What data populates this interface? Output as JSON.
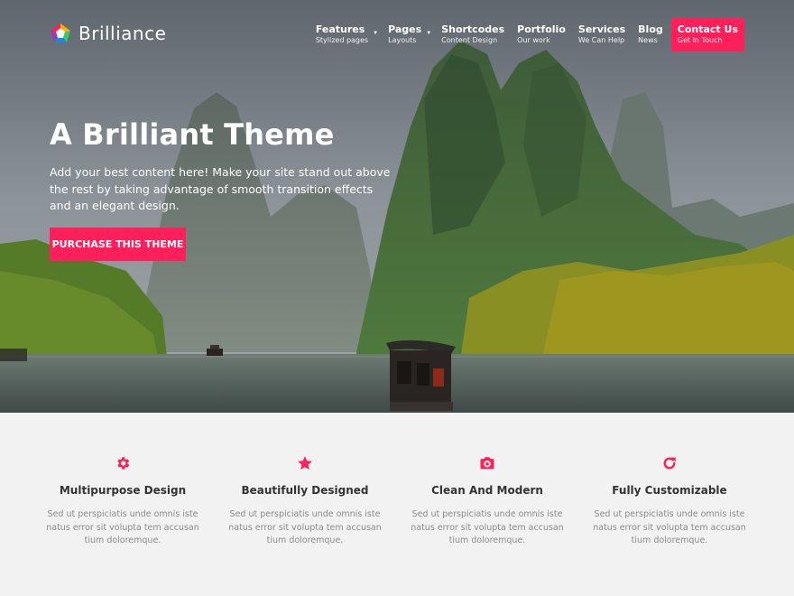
{
  "brand": {
    "name": "Brilliance",
    "accent": "#ff1f5a"
  },
  "nav": {
    "items": [
      {
        "title": "Features",
        "subtitle": "Stylized pages",
        "has_dropdown": true
      },
      {
        "title": "Pages",
        "subtitle": "Layouts",
        "has_dropdown": true
      },
      {
        "title": "Shortcodes",
        "subtitle": "Content Design",
        "has_dropdown": false
      },
      {
        "title": "Portfolio",
        "subtitle": "Our work",
        "has_dropdown": false
      },
      {
        "title": "Services",
        "subtitle": "We Can Help",
        "has_dropdown": false
      },
      {
        "title": "Blog",
        "subtitle": "News",
        "has_dropdown": false
      }
    ],
    "cta": {
      "title": "Contact Us",
      "subtitle": "Get In Touch"
    }
  },
  "hero": {
    "title": "A Brilliant Theme",
    "text": "Add your best content here! Make your site stand out above the rest by taking advantage of smooth transition effects and an elegant design.",
    "button_label": "PURCHASE THIS THEME"
  },
  "features": [
    {
      "icon": "gear-icon",
      "title": "Multipurpose Design",
      "description": "Sed ut perspiciatis unde omnis iste natus error sit volupta tem accusan tium doloremque."
    },
    {
      "icon": "star-icon",
      "title": "Beautifully Designed",
      "description": "Sed ut perspiciatis unde omnis iste natus error sit volupta tem accusan tium doloremque."
    },
    {
      "icon": "camera-icon",
      "title": "Clean And Modern",
      "description": "Sed ut perspiciatis unde omnis iste natus error sit volupta tem accusan tium doloremque."
    },
    {
      "icon": "refresh-icon",
      "title": "Fully Customizable",
      "description": "Sed ut perspiciatis unde omnis iste natus error sit volupta tem accusan tium doloremque."
    }
  ]
}
